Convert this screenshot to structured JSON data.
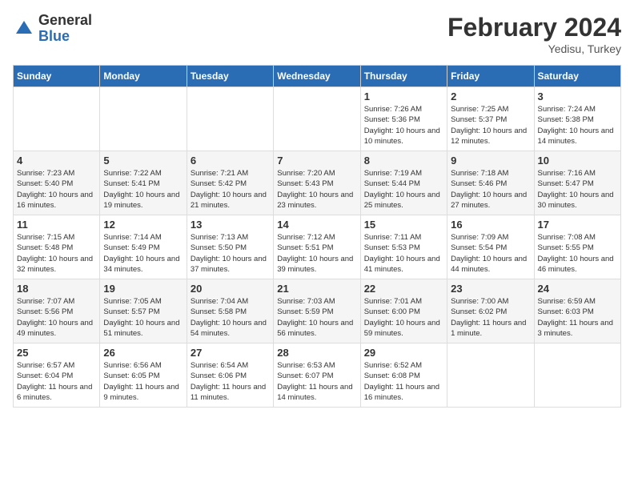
{
  "logo": {
    "general": "General",
    "blue": "Blue"
  },
  "title": "February 2024",
  "subtitle": "Yedisu, Turkey",
  "days_header": [
    "Sunday",
    "Monday",
    "Tuesday",
    "Wednesday",
    "Thursday",
    "Friday",
    "Saturday"
  ],
  "weeks": [
    [
      {
        "day": "",
        "sunrise": "",
        "sunset": "",
        "daylight": ""
      },
      {
        "day": "",
        "sunrise": "",
        "sunset": "",
        "daylight": ""
      },
      {
        "day": "",
        "sunrise": "",
        "sunset": "",
        "daylight": ""
      },
      {
        "day": "",
        "sunrise": "",
        "sunset": "",
        "daylight": ""
      },
      {
        "day": "1",
        "sunrise": "Sunrise: 7:26 AM",
        "sunset": "Sunset: 5:36 PM",
        "daylight": "Daylight: 10 hours and 10 minutes."
      },
      {
        "day": "2",
        "sunrise": "Sunrise: 7:25 AM",
        "sunset": "Sunset: 5:37 PM",
        "daylight": "Daylight: 10 hours and 12 minutes."
      },
      {
        "day": "3",
        "sunrise": "Sunrise: 7:24 AM",
        "sunset": "Sunset: 5:38 PM",
        "daylight": "Daylight: 10 hours and 14 minutes."
      }
    ],
    [
      {
        "day": "4",
        "sunrise": "Sunrise: 7:23 AM",
        "sunset": "Sunset: 5:40 PM",
        "daylight": "Daylight: 10 hours and 16 minutes."
      },
      {
        "day": "5",
        "sunrise": "Sunrise: 7:22 AM",
        "sunset": "Sunset: 5:41 PM",
        "daylight": "Daylight: 10 hours and 19 minutes."
      },
      {
        "day": "6",
        "sunrise": "Sunrise: 7:21 AM",
        "sunset": "Sunset: 5:42 PM",
        "daylight": "Daylight: 10 hours and 21 minutes."
      },
      {
        "day": "7",
        "sunrise": "Sunrise: 7:20 AM",
        "sunset": "Sunset: 5:43 PM",
        "daylight": "Daylight: 10 hours and 23 minutes."
      },
      {
        "day": "8",
        "sunrise": "Sunrise: 7:19 AM",
        "sunset": "Sunset: 5:44 PM",
        "daylight": "Daylight: 10 hours and 25 minutes."
      },
      {
        "day": "9",
        "sunrise": "Sunrise: 7:18 AM",
        "sunset": "Sunset: 5:46 PM",
        "daylight": "Daylight: 10 hours and 27 minutes."
      },
      {
        "day": "10",
        "sunrise": "Sunrise: 7:16 AM",
        "sunset": "Sunset: 5:47 PM",
        "daylight": "Daylight: 10 hours and 30 minutes."
      }
    ],
    [
      {
        "day": "11",
        "sunrise": "Sunrise: 7:15 AM",
        "sunset": "Sunset: 5:48 PM",
        "daylight": "Daylight: 10 hours and 32 minutes."
      },
      {
        "day": "12",
        "sunrise": "Sunrise: 7:14 AM",
        "sunset": "Sunset: 5:49 PM",
        "daylight": "Daylight: 10 hours and 34 minutes."
      },
      {
        "day": "13",
        "sunrise": "Sunrise: 7:13 AM",
        "sunset": "Sunset: 5:50 PM",
        "daylight": "Daylight: 10 hours and 37 minutes."
      },
      {
        "day": "14",
        "sunrise": "Sunrise: 7:12 AM",
        "sunset": "Sunset: 5:51 PM",
        "daylight": "Daylight: 10 hours and 39 minutes."
      },
      {
        "day": "15",
        "sunrise": "Sunrise: 7:11 AM",
        "sunset": "Sunset: 5:53 PM",
        "daylight": "Daylight: 10 hours and 41 minutes."
      },
      {
        "day": "16",
        "sunrise": "Sunrise: 7:09 AM",
        "sunset": "Sunset: 5:54 PM",
        "daylight": "Daylight: 10 hours and 44 minutes."
      },
      {
        "day": "17",
        "sunrise": "Sunrise: 7:08 AM",
        "sunset": "Sunset: 5:55 PM",
        "daylight": "Daylight: 10 hours and 46 minutes."
      }
    ],
    [
      {
        "day": "18",
        "sunrise": "Sunrise: 7:07 AM",
        "sunset": "Sunset: 5:56 PM",
        "daylight": "Daylight: 10 hours and 49 minutes."
      },
      {
        "day": "19",
        "sunrise": "Sunrise: 7:05 AM",
        "sunset": "Sunset: 5:57 PM",
        "daylight": "Daylight: 10 hours and 51 minutes."
      },
      {
        "day": "20",
        "sunrise": "Sunrise: 7:04 AM",
        "sunset": "Sunset: 5:58 PM",
        "daylight": "Daylight: 10 hours and 54 minutes."
      },
      {
        "day": "21",
        "sunrise": "Sunrise: 7:03 AM",
        "sunset": "Sunset: 5:59 PM",
        "daylight": "Daylight: 10 hours and 56 minutes."
      },
      {
        "day": "22",
        "sunrise": "Sunrise: 7:01 AM",
        "sunset": "Sunset: 6:00 PM",
        "daylight": "Daylight: 10 hours and 59 minutes."
      },
      {
        "day": "23",
        "sunrise": "Sunrise: 7:00 AM",
        "sunset": "Sunset: 6:02 PM",
        "daylight": "Daylight: 11 hours and 1 minute."
      },
      {
        "day": "24",
        "sunrise": "Sunrise: 6:59 AM",
        "sunset": "Sunset: 6:03 PM",
        "daylight": "Daylight: 11 hours and 3 minutes."
      }
    ],
    [
      {
        "day": "25",
        "sunrise": "Sunrise: 6:57 AM",
        "sunset": "Sunset: 6:04 PM",
        "daylight": "Daylight: 11 hours and 6 minutes."
      },
      {
        "day": "26",
        "sunrise": "Sunrise: 6:56 AM",
        "sunset": "Sunset: 6:05 PM",
        "daylight": "Daylight: 11 hours and 9 minutes."
      },
      {
        "day": "27",
        "sunrise": "Sunrise: 6:54 AM",
        "sunset": "Sunset: 6:06 PM",
        "daylight": "Daylight: 11 hours and 11 minutes."
      },
      {
        "day": "28",
        "sunrise": "Sunrise: 6:53 AM",
        "sunset": "Sunset: 6:07 PM",
        "daylight": "Daylight: 11 hours and 14 minutes."
      },
      {
        "day": "29",
        "sunrise": "Sunrise: 6:52 AM",
        "sunset": "Sunset: 6:08 PM",
        "daylight": "Daylight: 11 hours and 16 minutes."
      },
      {
        "day": "",
        "sunrise": "",
        "sunset": "",
        "daylight": ""
      },
      {
        "day": "",
        "sunrise": "",
        "sunset": "",
        "daylight": ""
      }
    ]
  ]
}
